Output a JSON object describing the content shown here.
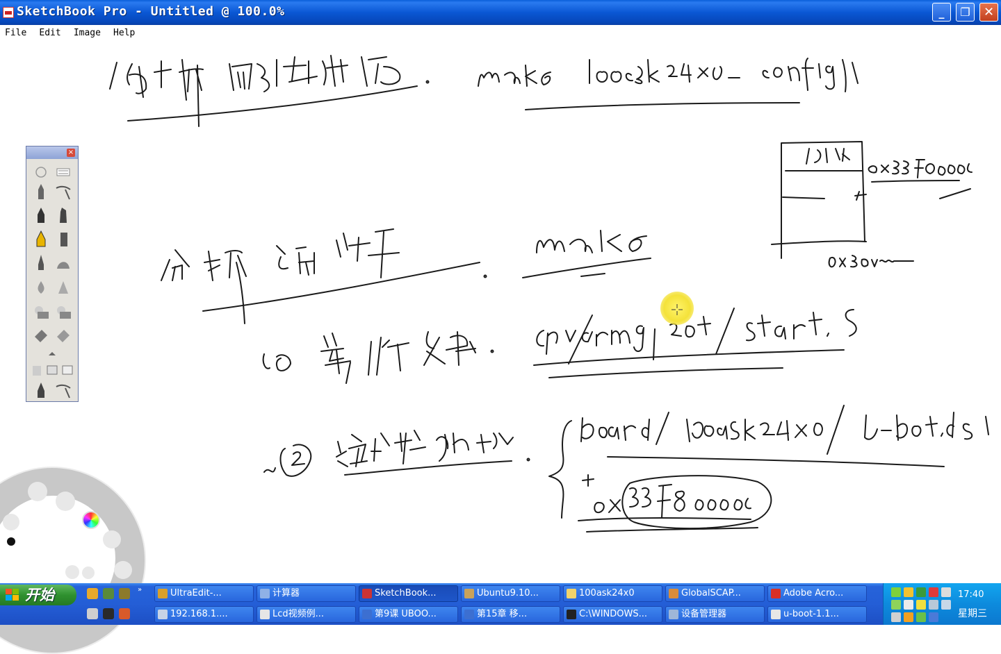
{
  "window": {
    "title": "SketchBook Pro - Untitled @ 100.0%",
    "buttons": {
      "minimize": "_",
      "maximize": "❐",
      "close": "✕"
    }
  },
  "menu": [
    "File",
    "Edit",
    "Image",
    "Help"
  ],
  "palette": {
    "close": "×"
  },
  "taskbar": {
    "start_label": "开始",
    "row1": [
      {
        "label": "UltraEdit-...",
        "icon": "ultraedit-icon",
        "color": "#d9a02b"
      },
      {
        "label": "计算器",
        "icon": "calculator-icon",
        "color": "#8fb1e6"
      },
      {
        "label": "SketchBook...",
        "icon": "sketchbook-icon",
        "color": "#cc3333",
        "active": true
      },
      {
        "label": "Ubuntu9.10...",
        "icon": "vmware-icon",
        "color": "#c9a25a"
      },
      {
        "label": "100ask24x0",
        "icon": "folder-icon",
        "color": "#f2d36b"
      },
      {
        "label": "GlobalSCAP...",
        "icon": "globalscape-icon",
        "color": "#d98c3a"
      },
      {
        "label": "Adobe Acro...",
        "icon": "acrobat-icon",
        "color": "#d93025"
      }
    ],
    "row2": [
      {
        "label": "192.168.1....",
        "icon": "terminal-icon",
        "color": "#c7d3e6"
      },
      {
        "label": "Lcd视频例...",
        "icon": "disc-icon",
        "color": "#e6e6e6"
      },
      {
        "label": "第9课 UBOO...",
        "icon": "word-icon",
        "color": "#3c6fd1"
      },
      {
        "label": "第15章 移...",
        "icon": "word-icon",
        "color": "#3c6fd1"
      },
      {
        "label": "C:\\WINDOWS...",
        "icon": "cmd-icon",
        "color": "#222222"
      },
      {
        "label": "设备管理器",
        "icon": "devmgr-icon",
        "color": "#9fb6d8"
      },
      {
        "label": "u-boot-1.1...",
        "icon": "disc-icon",
        "color": "#e6e6e6"
      }
    ],
    "clock_time": "17:40",
    "clock_day": "星期三"
  },
  "colors": {
    "titlebar": "#0a57d4",
    "taskbar": "#245ed6",
    "start": "#2f912f",
    "tray": "#0d8bdd"
  }
}
